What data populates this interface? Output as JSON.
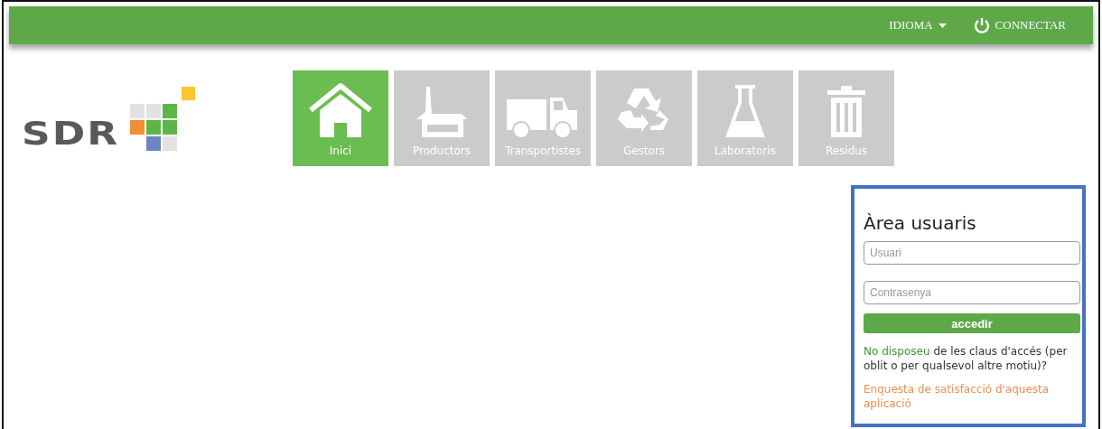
{
  "topbar": {
    "language": "IDIOMA",
    "connect": "CONNECTAR"
  },
  "logo": {
    "text": "SDR"
  },
  "tiles": [
    {
      "label": "Inici",
      "kind": "home",
      "selected": true
    },
    {
      "label": "Productors",
      "kind": "factory",
      "selected": false
    },
    {
      "label": "Transportistes",
      "kind": "truck",
      "selected": false
    },
    {
      "label": "Gestors",
      "kind": "recycle",
      "selected": false
    },
    {
      "label": "Laboratoris",
      "kind": "flask",
      "selected": false
    },
    {
      "label": "Residus",
      "kind": "trash",
      "selected": false
    }
  ],
  "login": {
    "title": "Àrea usuaris",
    "user": {
      "placeholder": "Usuari"
    },
    "password": {
      "placeholder": "Contrasenya"
    },
    "submit": "accedir",
    "recover_link": "No disposeu",
    "recover_text": "de les claus d'accés (per oblit o per qualsevol altre motiu)?",
    "survey_link": "Enquesta de satisfacció d'aquesta aplicació"
  }
}
